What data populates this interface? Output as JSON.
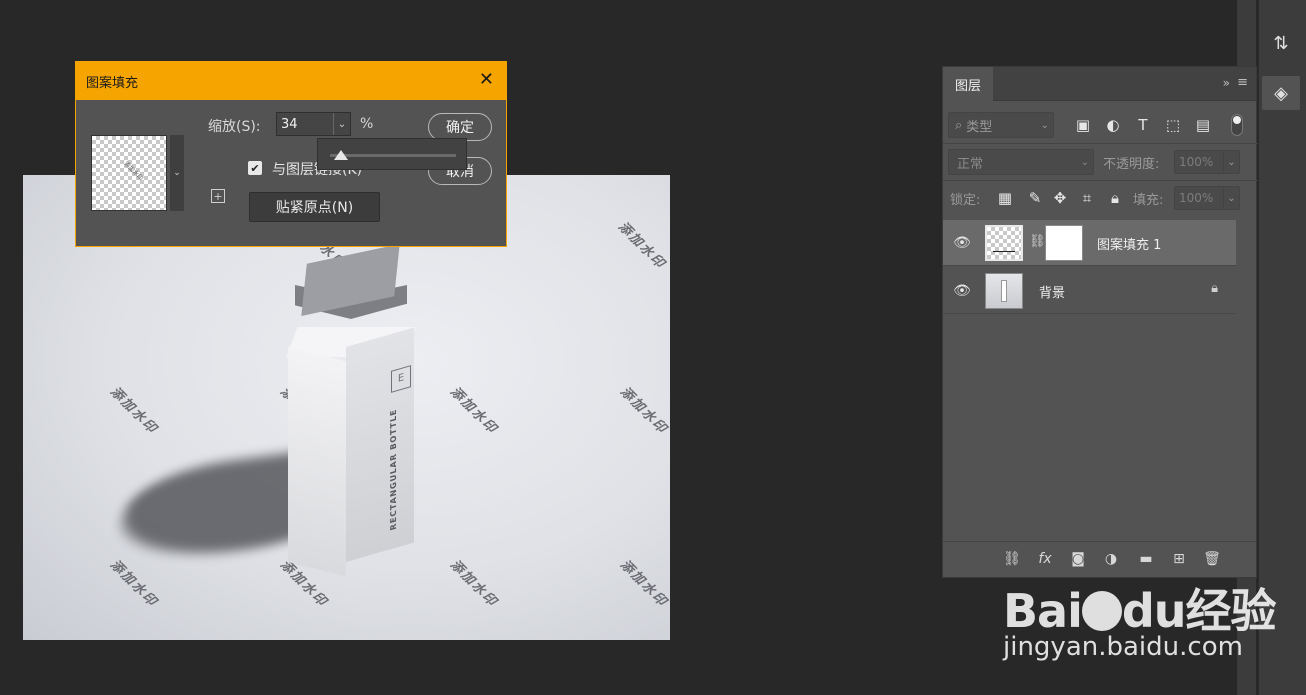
{
  "dialog": {
    "title": "图案填充",
    "scale_label": "缩放(S):",
    "scale_value": "34",
    "scale_unit": "%",
    "slider_value_percent": 34,
    "ok_label": "确定",
    "cancel_label": "取消",
    "snap_checkbox_label": "与图层链接(K)",
    "snap_checked": true,
    "snap_origin_label": "贴紧原点(N)"
  },
  "layers_panel": {
    "tab_label": "图层",
    "filter_placeholder": "类型",
    "blend_mode": "正常",
    "opacity_label": "不透明度:",
    "opacity_value": "100%",
    "lock_label": "锁定:",
    "fill_label": "填充:",
    "fill_value": "100%",
    "layers": [
      {
        "name": "图案填充 1",
        "selected": true,
        "type": "pattern-fill"
      },
      {
        "name": "背景",
        "selected": false,
        "locked": true,
        "type": "background"
      }
    ]
  },
  "canvas": {
    "watermark_text": "添加水印",
    "bottle_label": "RECTANGULAR BOTTLE",
    "emblem_letter": "E"
  },
  "branding": {
    "logo_text_left": "Bai",
    "logo_text_right": "du经验",
    "url": "jingyan.baidu.com"
  },
  "colors": {
    "dialog_accent": "#f5a400",
    "panel_bg": "#535353",
    "workspace_bg": "#282828"
  }
}
